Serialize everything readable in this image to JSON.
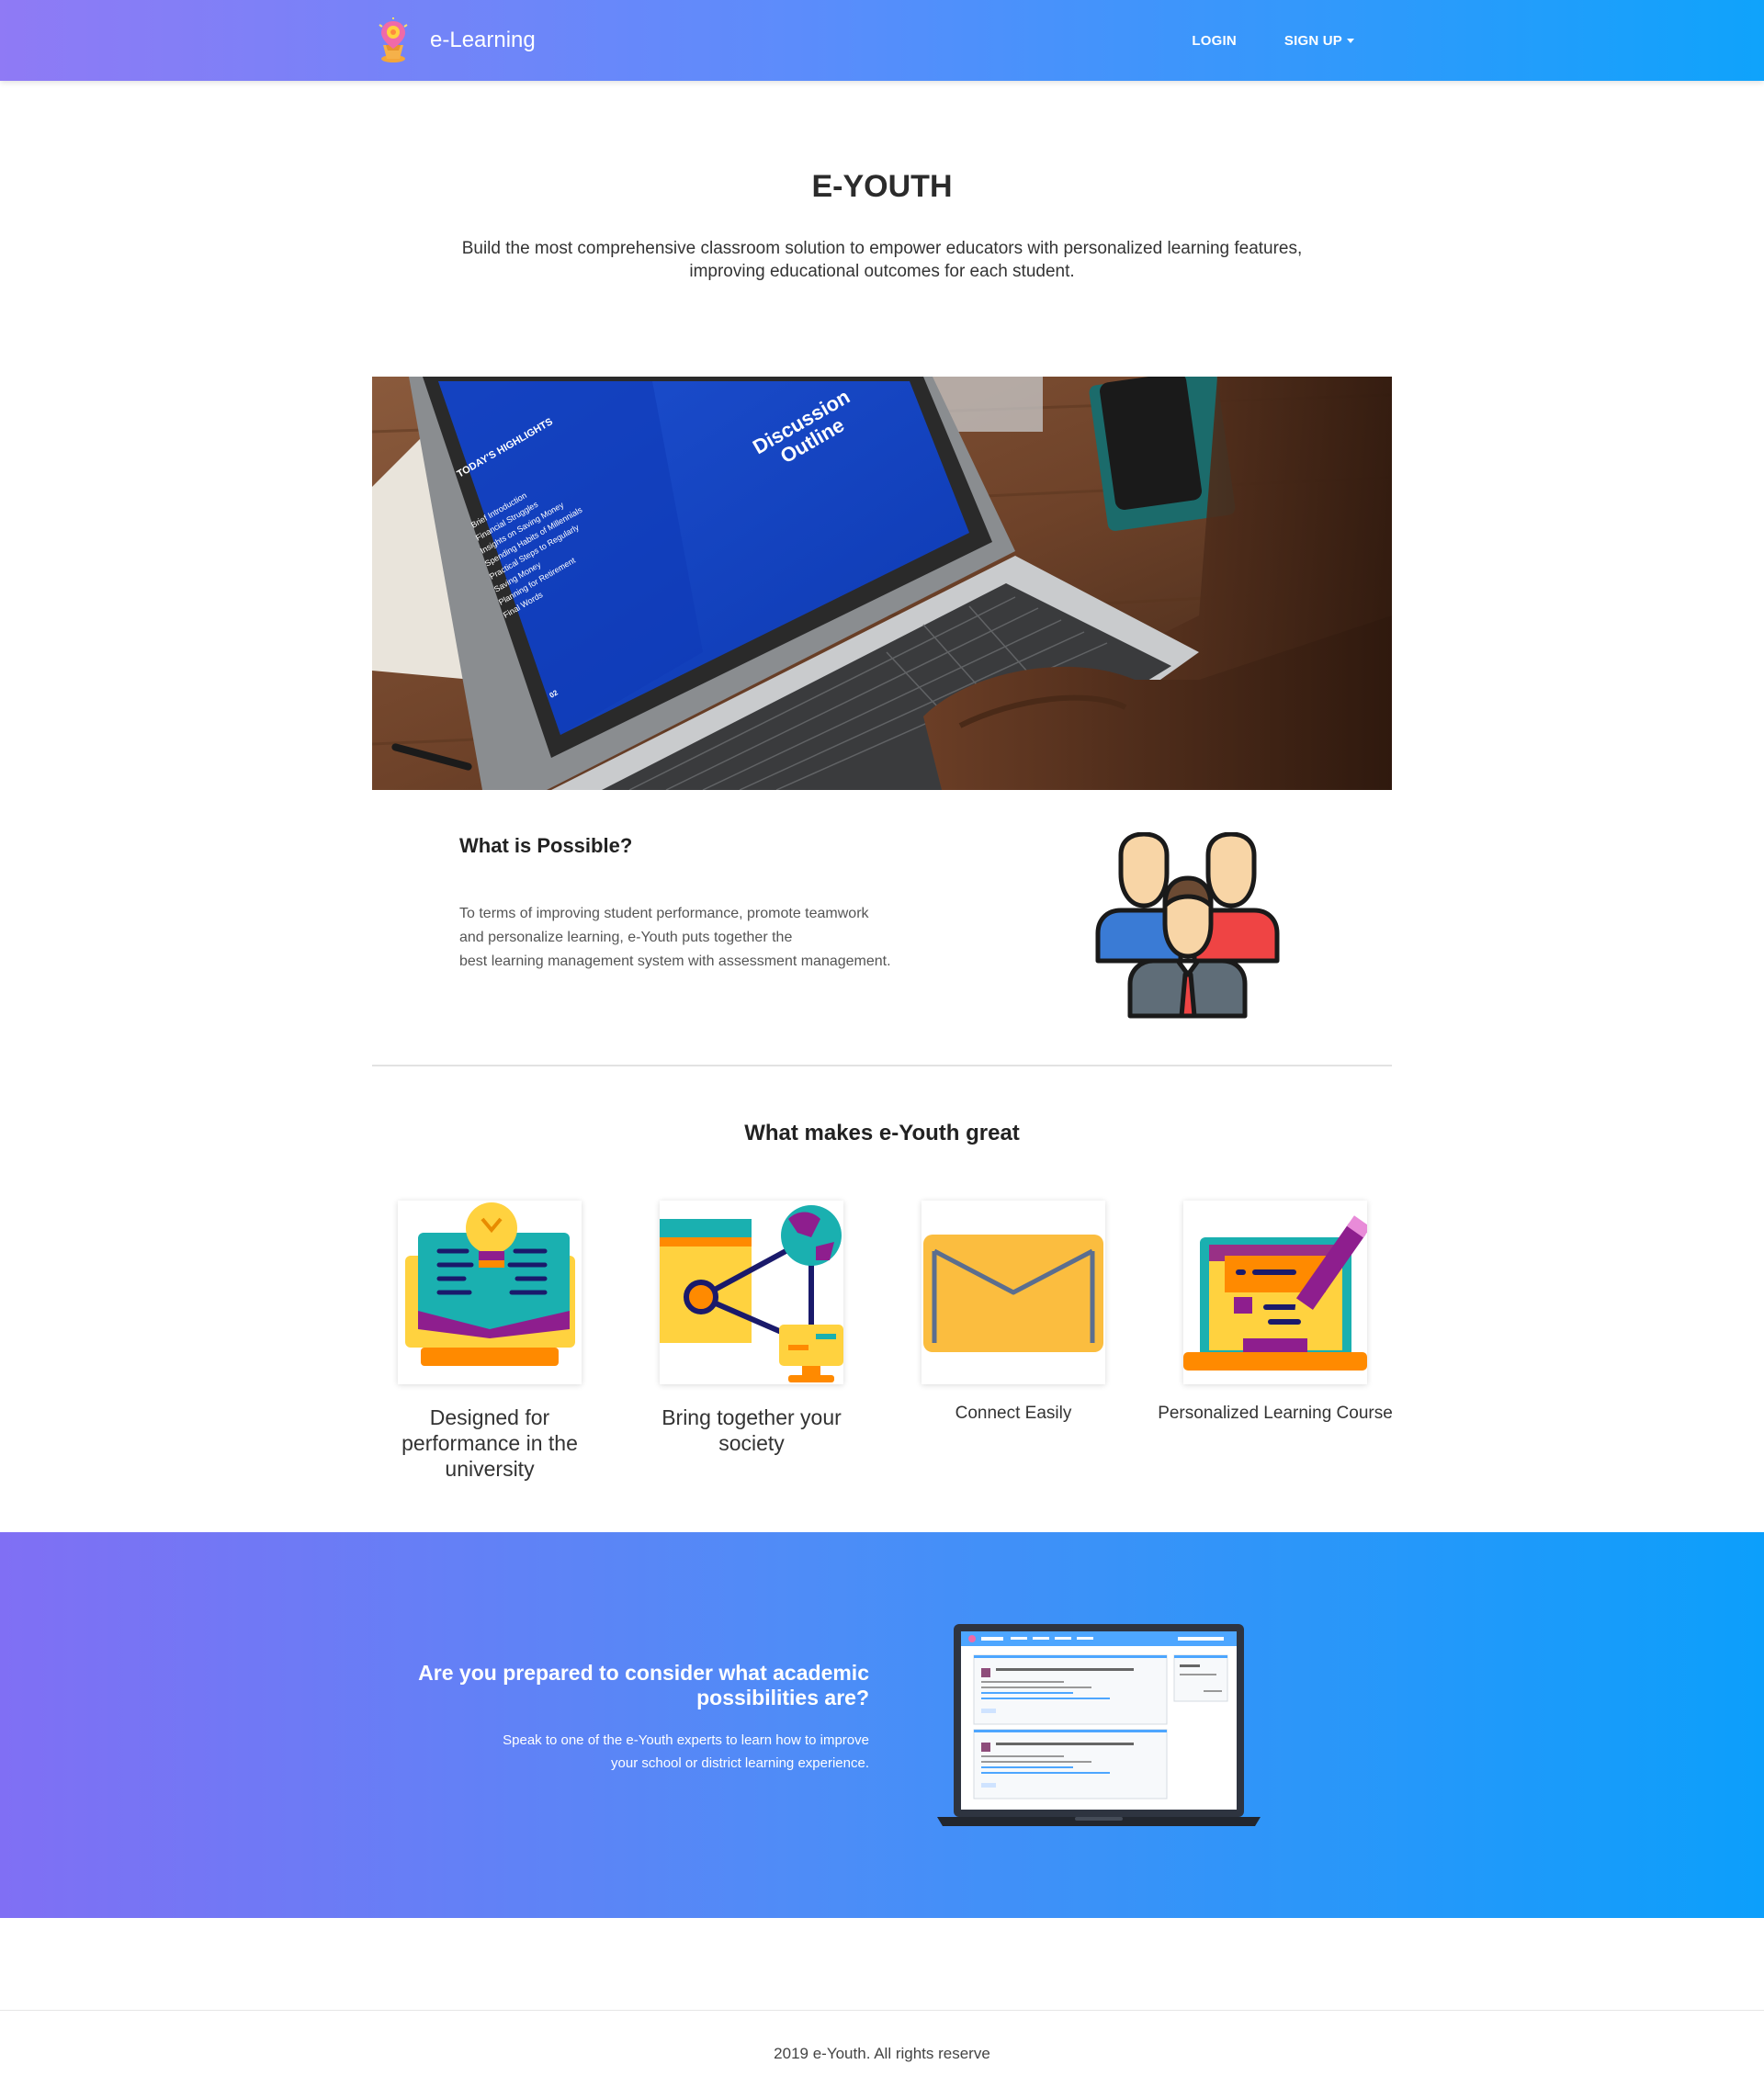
{
  "navbar": {
    "brand": "e-Learning",
    "login": "LOGIN",
    "signup": "SIGN UP",
    "colors": {
      "gradient_start": "#8f7af5",
      "gradient_end": "#0fa3fb"
    }
  },
  "hero": {
    "title": "E-YOUTH",
    "subtitle_line1": "Build the most comprehensive classroom solution to empower educators with personalized learning features,",
    "subtitle_line2": "improving educational outcomes for each student."
  },
  "hero_image": {
    "screen_left_title": "TODAY'S HIGHLIGHTS",
    "screen_right_title_1": "Discussion",
    "screen_right_title_2": "Outline",
    "screen_list": [
      "Brief Introduction",
      "Financial Struggles",
      "Insights on Saving Money",
      "Spending Habits of Millennials",
      "Practical Steps to Regularly",
      "Saving Money",
      "Planning for Retirement",
      "Final Words"
    ],
    "screen_page": "02"
  },
  "possible": {
    "heading": "What is Possible?",
    "text_line1": "To terms of improving student performance, promote teamwork",
    "text_line2": "and personalize learning, e-Youth puts together the",
    "text_line3": "best learning management system with assessment management.",
    "icon": "team-icon"
  },
  "features": {
    "heading": "What makes e-Youth great",
    "items": [
      {
        "label": "Designed for performance in the university",
        "icon": "idea-monitor-icon"
      },
      {
        "label": "Bring together your society",
        "icon": "network-share-icon"
      },
      {
        "label": "Connect Easily",
        "icon": "envelope-icon"
      },
      {
        "label": "Personalized Learning Course",
        "icon": "laptop-pencil-icon"
      }
    ]
  },
  "cta": {
    "heading_line1": "Are you prepared to consider what academic",
    "heading_line2": "possibilities are?",
    "text_line1": "Speak to one of the e-Youth experts to learn how to improve",
    "text_line2": "your school or district learning experience.",
    "image": "laptop-screenshot"
  },
  "footer": {
    "text": "2019 e-Youth. All rights reserve"
  }
}
